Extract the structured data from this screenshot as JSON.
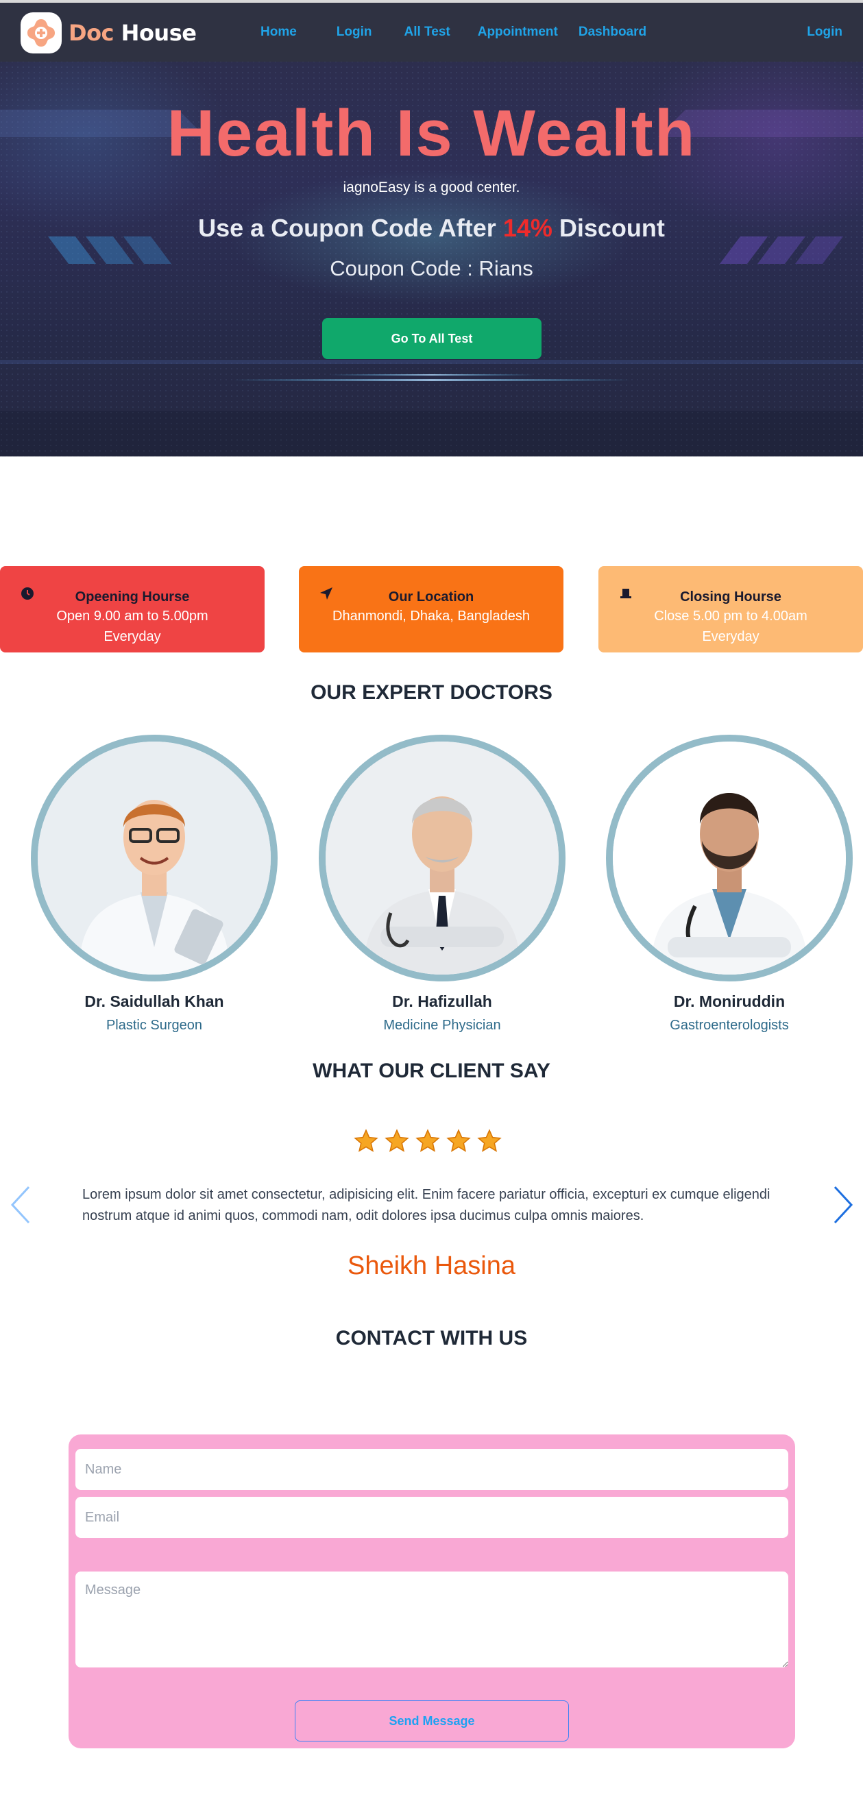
{
  "brand": {
    "name_part1": "Doc",
    "name_part2": "House"
  },
  "nav": {
    "links": [
      "Home",
      "Login",
      "All Test",
      "Appointment",
      "Dashboard"
    ],
    "right_login": "Login"
  },
  "hero": {
    "title": "Health Is Wealth",
    "subtitle": "iagnoEasy is a good center.",
    "coupon_prefix": "Use a Coupon Code After",
    "coupon_percent": "14%",
    "coupon_suffix": "Discount",
    "coupon_code": "Coupon Code : Rians",
    "button": "Go To All Test"
  },
  "info_cards": [
    {
      "title": "Opeening Hourse",
      "line1": "Open 9.00 am to 5.00pm",
      "line2": "Everyday",
      "icon": "clock-icon",
      "color": "#ef4444"
    },
    {
      "title": "Our Location",
      "line1": "Dhanmondi, Dhaka, Bangladesh",
      "line2": "",
      "icon": "location-arrow-icon",
      "color": "#f97316"
    },
    {
      "title": "Closing Hourse",
      "line1": "Close 5.00 pm to 4.00am",
      "line2": "Everyday",
      "icon": "hat-icon",
      "color": "#fdba74"
    }
  ],
  "doctors_section": {
    "title": "OUR EXPERT DOCTORS"
  },
  "doctors": [
    {
      "name": "Dr. Saidullah Khan",
      "role": "Plastic Surgeon"
    },
    {
      "name": "Dr. Hafizullah",
      "role": "Medicine Physician"
    },
    {
      "name": "Dr. Moniruddin",
      "role": "Gastroenterologists"
    }
  ],
  "testimonial": {
    "title": "WHAT OUR CLIENT SAY",
    "rating": 5,
    "text": "Lorem ipsum dolor sit amet consectetur, adipisicing elit. Enim facere pariatur officia, excepturi ex cumque eligendi nostrum atque id animi quos, commodi nam, odit dolores ipsa ducimus culpa omnis maiores.",
    "client": "Sheikh Hasina"
  },
  "contact": {
    "title": "CONTACT WITH US",
    "name_placeholder": "Name",
    "email_placeholder": "Email",
    "message_placeholder": "Message",
    "button": "Send Message"
  }
}
